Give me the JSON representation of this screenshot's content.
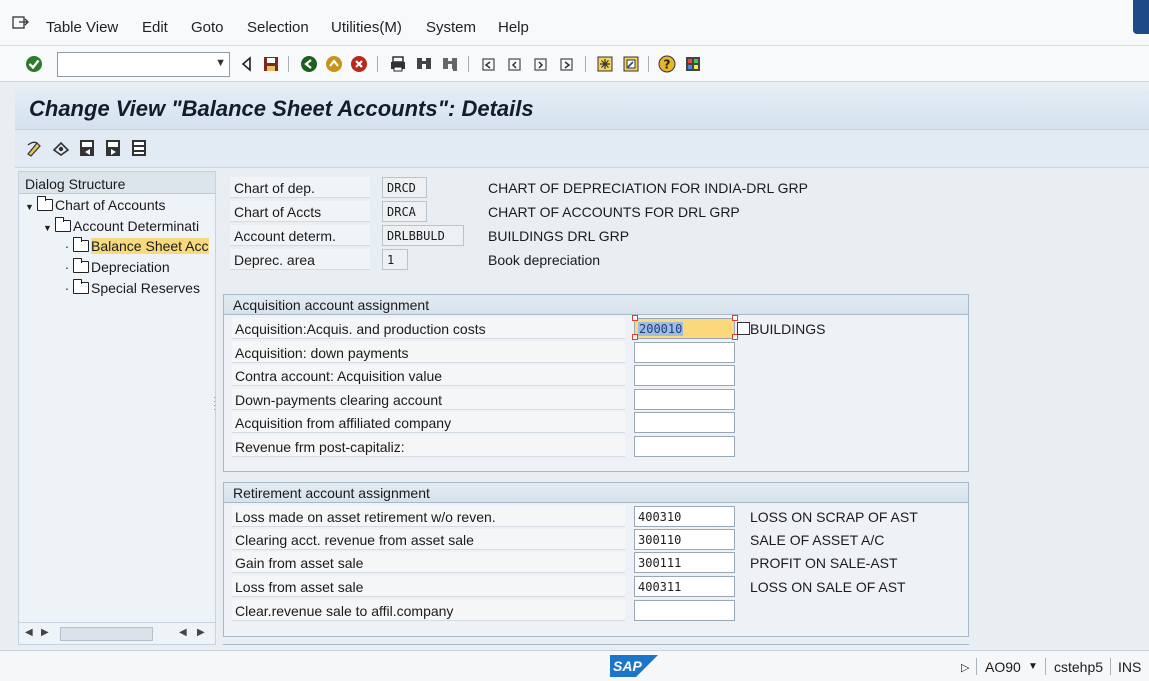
{
  "menu": {
    "items": [
      "Table View",
      "Edit",
      "Goto",
      "Selection",
      "Utilities(M)",
      "System",
      "Help"
    ]
  },
  "toolbar": {
    "command_value": "",
    "icons": [
      "back-triangle-icon",
      "save-icon",
      "back-icon",
      "exit-icon",
      "cancel-icon",
      "print-icon",
      "find-icon",
      "find-next-icon",
      "first-page-icon",
      "previous-page-icon",
      "next-page-icon",
      "last-page-icon",
      "create-session-icon",
      "shortcut-icon",
      "help-icon",
      "layout-menu-icon"
    ]
  },
  "title": "Change View \"Balance Sheet Accounts\": Details",
  "tree": {
    "header": "Dialog Structure",
    "nodes": [
      "Chart of Accounts",
      "Account Determinati",
      "Balance Sheet Acc",
      "Depreciation",
      "Special Reserves"
    ]
  },
  "header_fields": [
    {
      "label": "Chart of dep.",
      "code": "DRCD",
      "desc": "CHART OF DEPRECIATION FOR INDIA-DRL GRP"
    },
    {
      "label": "Chart of Accts",
      "code": "DRCA",
      "desc": "CHART OF ACCOUNTS FOR DRL GRP"
    },
    {
      "label": "Account determ.",
      "code": "DRLBBULD",
      "desc": "BUILDINGS DRL GRP"
    },
    {
      "label": "Deprec. area",
      "code": "1",
      "desc": "Book depreciation"
    }
  ],
  "acquisition": {
    "title": "Acquisition account assignment",
    "rows": [
      {
        "label": "Acquisition:Acquis. and production costs",
        "value": "200010",
        "desc": "BUILDINGS"
      },
      {
        "label": "Acquisition: down payments",
        "value": "",
        "desc": ""
      },
      {
        "label": "Contra account: Acquisition value",
        "value": "",
        "desc": ""
      },
      {
        "label": "Down-payments clearing account",
        "value": "",
        "desc": ""
      },
      {
        "label": "Acquisition from affiliated company",
        "value": "",
        "desc": ""
      },
      {
        "label": "Revenue frm post-capitaliz:",
        "value": "",
        "desc": ""
      }
    ]
  },
  "retirement": {
    "title": "Retirement account assignment",
    "rows": [
      {
        "label": "Loss made on asset retirement w/o reven.",
        "value": "400310",
        "desc": "LOSS ON SCRAP OF AST"
      },
      {
        "label": "Clearing acct. revenue from asset sale",
        "value": "300110",
        "desc": "SALE OF ASSET A/C"
      },
      {
        "label": "Gain from asset sale",
        "value": "300111",
        "desc": "PROFIT ON SALE-AST"
      },
      {
        "label": "Loss from asset sale",
        "value": "400311",
        "desc": "LOSS ON SALE OF AST"
      },
      {
        "label": "Clear.revenue sale to affil.company",
        "value": "",
        "desc": ""
      }
    ]
  },
  "status": {
    "logo": "SAP",
    "transaction": "AO90",
    "server": "cstehp5",
    "mode": "INS"
  },
  "colors": {
    "title_bg": "#d5e2ee",
    "focus_field": "#fbd97a",
    "selected_node": "#f7d97e",
    "sap_blue": "#1b75c9"
  }
}
